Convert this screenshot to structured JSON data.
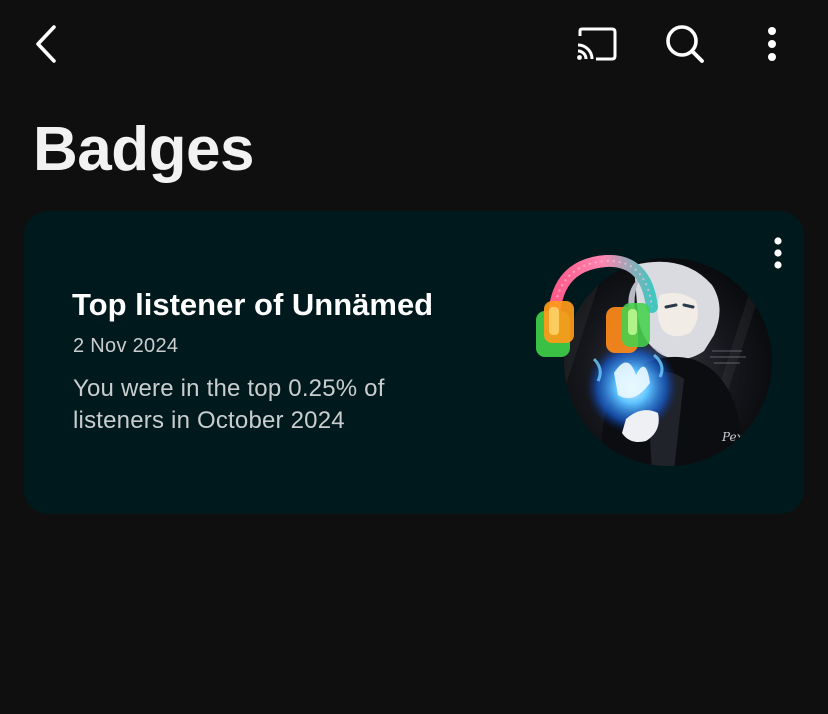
{
  "header": {
    "back_icon": "chevron-left-icon",
    "cast_icon": "cast-icon",
    "search_icon": "search-icon",
    "more_icon": "more-vertical-icon"
  },
  "page": {
    "title": "Badges"
  },
  "badge": {
    "title": "Top listener of Unnämed",
    "date": "2 Nov 2024",
    "description": "You were in the top 0.25% of listeners in October 2024",
    "more_icon": "more-vertical-icon",
    "art": "album-art-with-headphones"
  },
  "colors": {
    "background": "#0f0f0f",
    "card": "#00191d",
    "text_primary": "#ffffff",
    "text_secondary": "#c9cdce"
  }
}
